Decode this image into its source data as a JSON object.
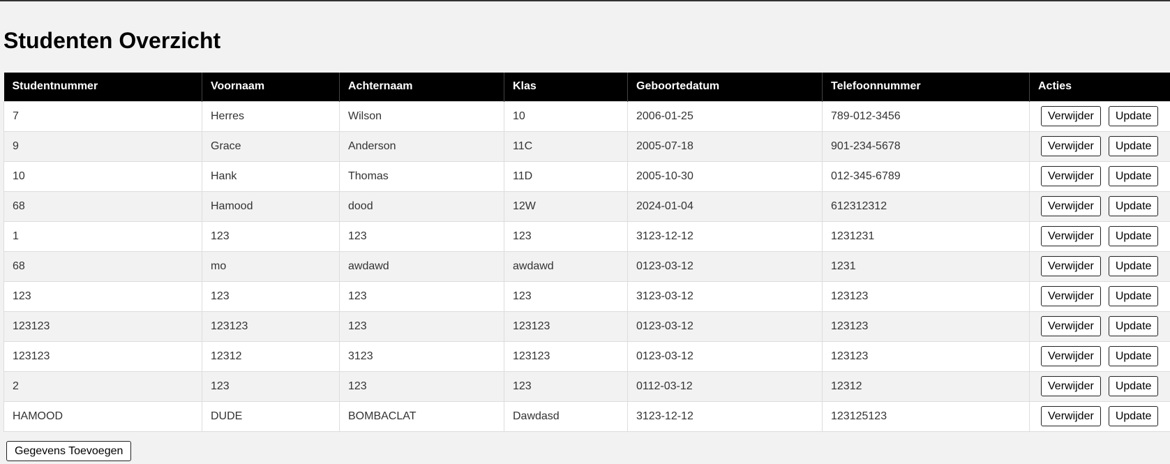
{
  "page": {
    "title": "Studenten Overzicht",
    "add_button_label": "Gegevens Toevoegen"
  },
  "table": {
    "headers": [
      "Studentnummer",
      "Voornaam",
      "Achternaam",
      "Klas",
      "Geboortedatum",
      "Telefoonnummer",
      "Acties"
    ],
    "action_labels": {
      "delete": "Verwijder",
      "update": "Update"
    },
    "rows": [
      [
        "7",
        "Herres",
        "Wilson",
        "10",
        "2006-01-25",
        "789-012-3456"
      ],
      [
        "9",
        "Grace",
        "Anderson",
        "11C",
        "2005-07-18",
        "901-234-5678"
      ],
      [
        "10",
        "Hank",
        "Thomas",
        "11D",
        "2005-10-30",
        "012-345-6789"
      ],
      [
        "68",
        "Hamood",
        "dood",
        "12W",
        "2024-01-04",
        "612312312"
      ],
      [
        "1",
        "123",
        "123",
        "123",
        "3123-12-12",
        "1231231"
      ],
      [
        "68",
        "mo",
        "awdawd",
        "awdawd",
        "0123-03-12",
        "1231"
      ],
      [
        "123",
        "123",
        "123",
        "123",
        "3123-03-12",
        "123123"
      ],
      [
        "123123",
        "123123",
        "123",
        "123123",
        "0123-03-12",
        "123123"
      ],
      [
        "123123",
        "12312",
        "3123",
        "123123",
        "0123-03-12",
        "123123"
      ],
      [
        "2",
        "123",
        "123",
        "123",
        "0112-03-12",
        "12312"
      ],
      [
        "HAMOOD",
        "DUDE",
        "BOMBACLAT",
        "Dawdasd",
        "3123-12-12",
        "123125123"
      ]
    ]
  }
}
